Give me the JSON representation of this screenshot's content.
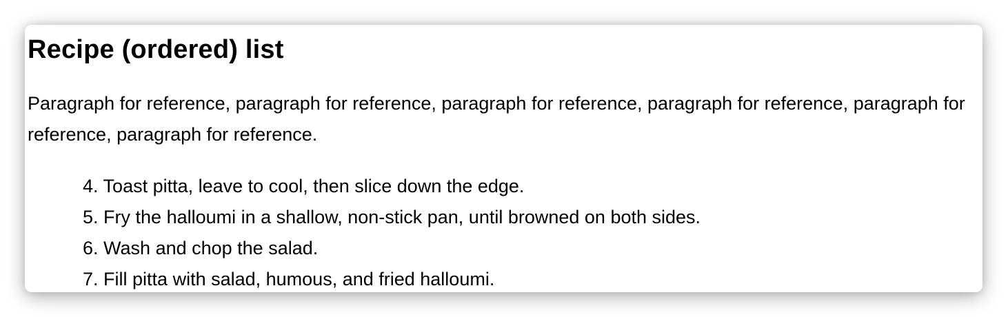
{
  "heading": "Recipe (ordered) list",
  "paragraph": "Paragraph for reference, paragraph for reference, paragraph for reference, paragraph for reference, paragraph for reference, paragraph for reference.",
  "steps": [
    {
      "number": "4.",
      "text": "Toast pitta, leave to cool, then slice down the edge."
    },
    {
      "number": "5.",
      "text": "Fry the halloumi in a shallow, non-stick pan, until browned on both sides."
    },
    {
      "number": "6.",
      "text": "Wash and chop the salad."
    },
    {
      "number": "7.",
      "text": "Fill pitta with salad, humous, and fried halloumi."
    }
  ]
}
